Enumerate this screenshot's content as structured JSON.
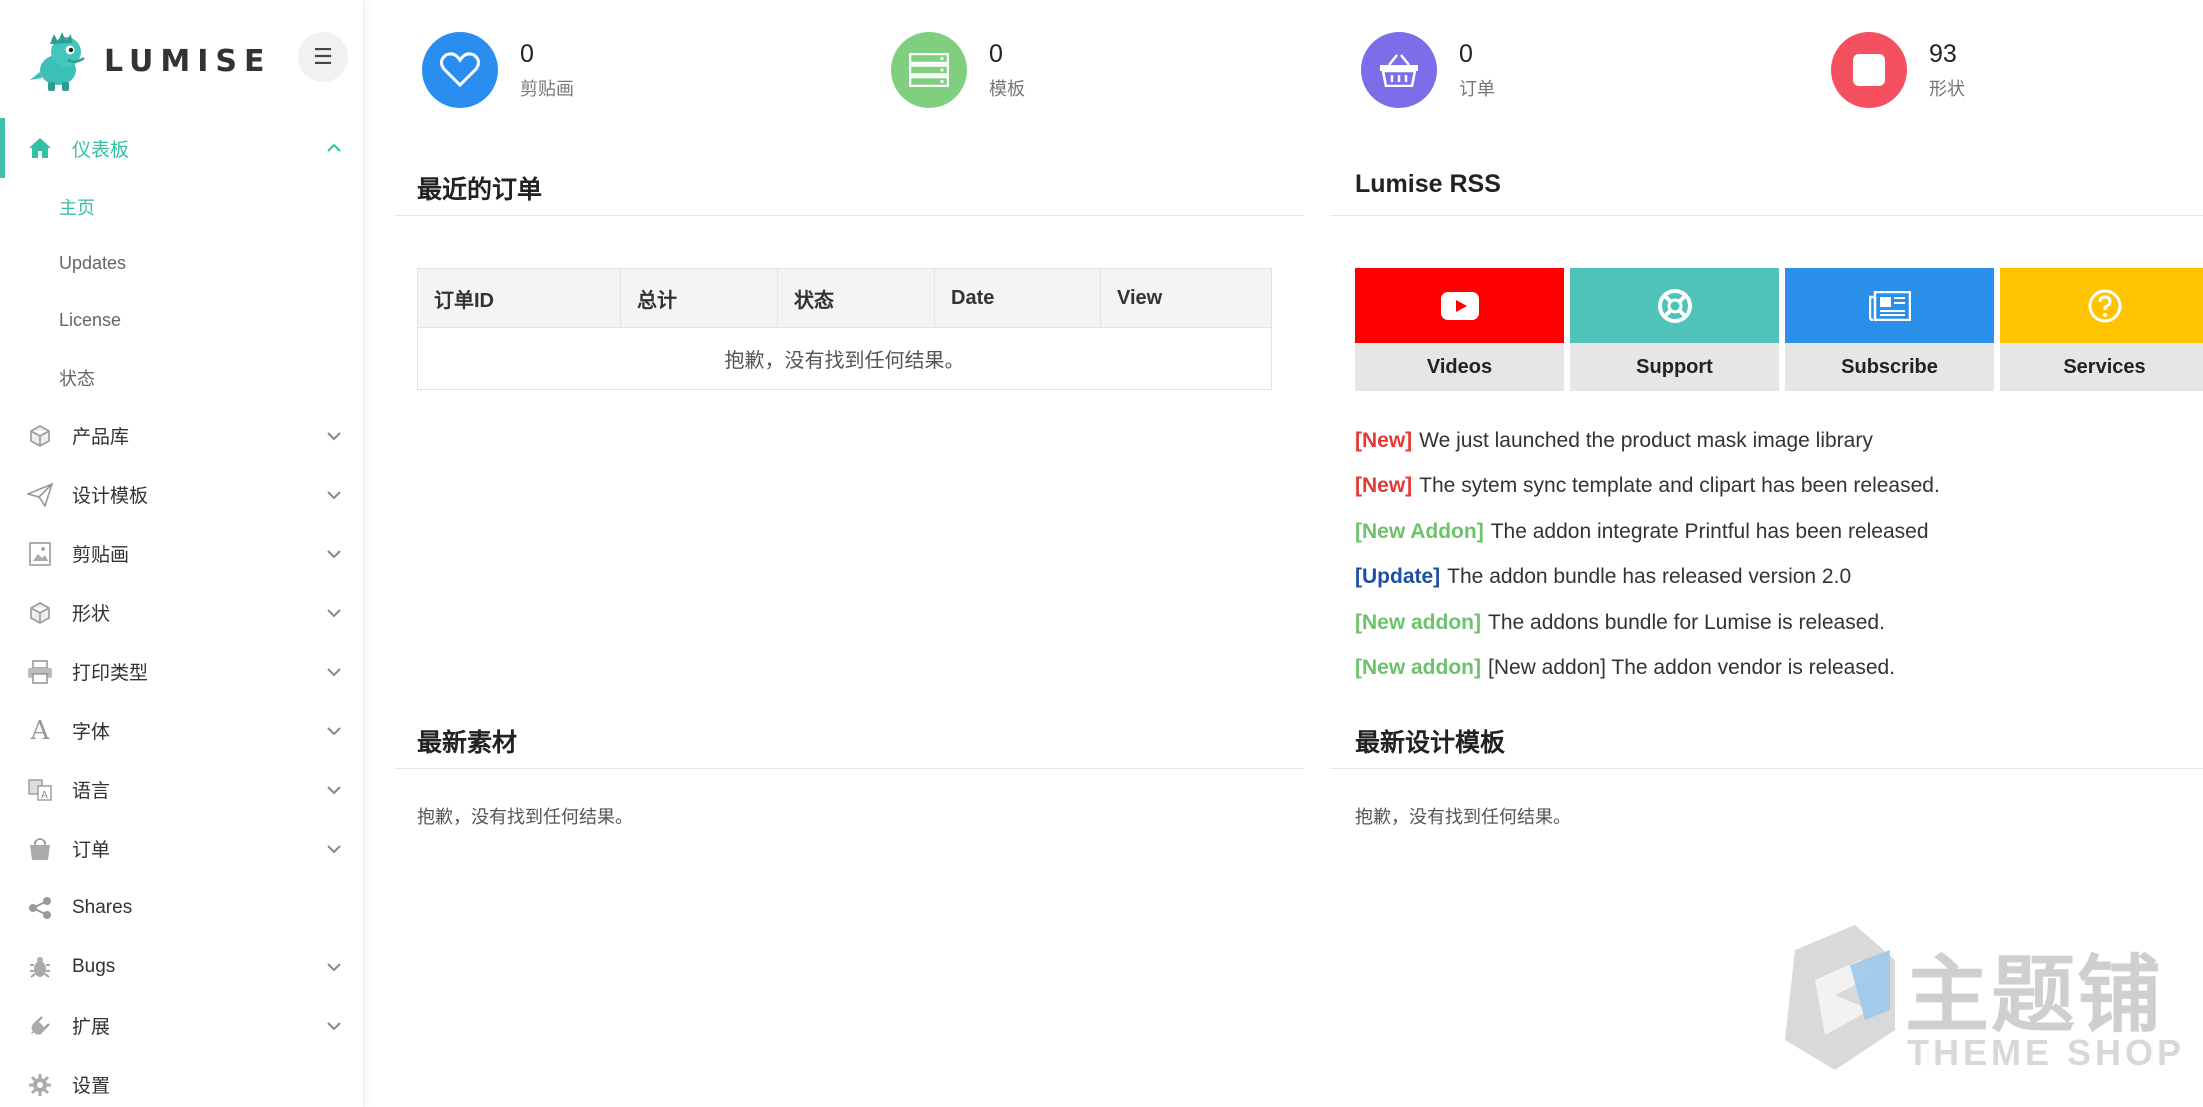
{
  "brand": {
    "name": "LUMISE"
  },
  "sidebar": {
    "items": [
      {
        "label": "仪表板",
        "icon": "home-icon",
        "active": true,
        "expandable": true
      },
      {
        "label": "产品库",
        "icon": "cube-icon",
        "expandable": true
      },
      {
        "label": "设计模板",
        "icon": "paper-plane-icon",
        "expandable": true
      },
      {
        "label": "剪贴画",
        "icon": "image-icon",
        "expandable": true
      },
      {
        "label": "形状",
        "icon": "cube-icon",
        "expandable": true
      },
      {
        "label": "打印类型",
        "icon": "printer-icon",
        "expandable": true
      },
      {
        "label": "字体",
        "icon": "font-icon",
        "expandable": true
      },
      {
        "label": "语言",
        "icon": "language-icon",
        "expandable": true
      },
      {
        "label": "订单",
        "icon": "shopping-bag-icon",
        "expandable": true
      },
      {
        "label": "Shares",
        "icon": "share-icon",
        "expandable": false
      },
      {
        "label": "Bugs",
        "icon": "bug-icon",
        "expandable": true
      },
      {
        "label": "扩展",
        "icon": "plug-icon",
        "expandable": true
      },
      {
        "label": "设置",
        "icon": "gear-icon",
        "expandable": false
      }
    ],
    "sub_items": [
      "主页",
      "Updates",
      "License",
      "状态"
    ]
  },
  "stats": [
    {
      "value": "0",
      "label": "剪贴画",
      "color": "#2a8ef0",
      "icon": "heart-icon"
    },
    {
      "value": "0",
      "label": "模板",
      "color": "#7fcf7f",
      "icon": "server-icon"
    },
    {
      "value": "0",
      "label": "订单",
      "color": "#7c6ee8",
      "icon": "basket-icon"
    },
    {
      "value": "93",
      "label": "形状",
      "color": "#f5505f",
      "icon": "square-icon"
    }
  ],
  "recent_orders": {
    "title": "最近的订单",
    "columns": [
      "订单ID",
      "总计",
      "状态",
      "Date",
      "View"
    ],
    "empty": "抱歉，没有找到任何结果。"
  },
  "rss": {
    "title": "Lumise RSS",
    "tiles": [
      {
        "label": "Videos",
        "color": "#ff0000",
        "icon": "youtube-icon"
      },
      {
        "label": "Support",
        "color": "#4fc3b9",
        "icon": "lifebuoy-icon"
      },
      {
        "label": "Subscribe",
        "color": "#2a8fe8",
        "icon": "newspaper-icon"
      },
      {
        "label": "Services",
        "color": "#ffc300",
        "icon": "question-icon"
      }
    ],
    "news": [
      {
        "tag": "[New]",
        "tag_color": "#e53935",
        "text": "We just launched the product mask image library"
      },
      {
        "tag": "[New]",
        "tag_color": "#e53935",
        "text": "The sytem sync template and clipart has been released."
      },
      {
        "tag": "[New Addon]",
        "tag_color": "#6cc36c",
        "text": "The addon integrate Printful has been released"
      },
      {
        "tag": "[Update]",
        "tag_color": "#1e4fa8",
        "text": "The addon bundle has released version 2.0"
      },
      {
        "tag": "[New addon]",
        "tag_color": "#6cc36c",
        "text": "The addons bundle for Lumise is released."
      },
      {
        "tag": "[New addon]",
        "tag_color": "#6cc36c",
        "text": "[New addon] The addon vendor is released."
      }
    ]
  },
  "latest_materials": {
    "title": "最新素材",
    "empty": "抱歉，没有找到任何结果。"
  },
  "latest_templates": {
    "title": "最新设计模板",
    "empty": "抱歉，没有找到任何结果。"
  },
  "watermark": {
    "cn": "主题铺",
    "en": "THEME SHOP"
  }
}
